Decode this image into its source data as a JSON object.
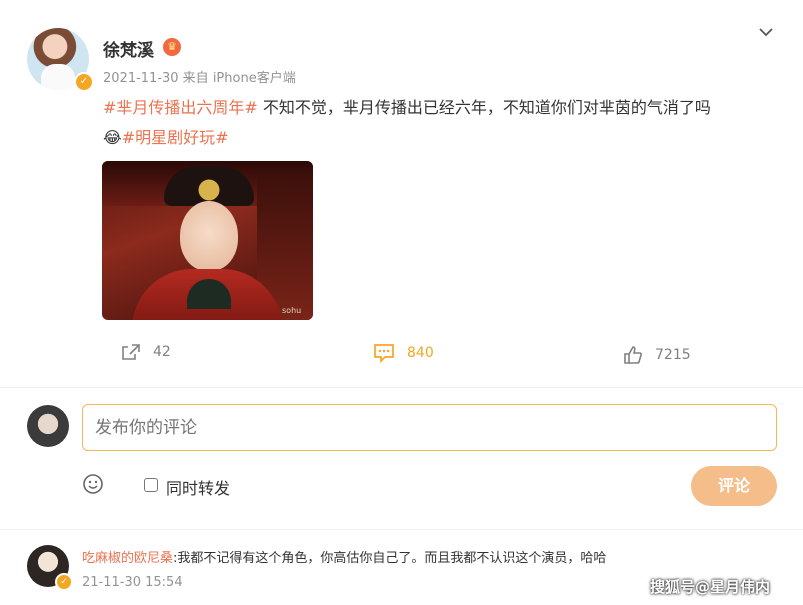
{
  "post": {
    "author": "徐梵溪",
    "meta": "2021-11-30  来自 iPhone客户端",
    "hashtag1": "#芈月传播出六周年#",
    "text": " 不知不觉，芈月传播出已经六年，不知道你们对芈茵的气消了吗",
    "emoji": "😂",
    "hashtag2": "#明星剧好玩#",
    "watermark": "sohu",
    "menu_icon": "chevron-down-icon"
  },
  "actions": {
    "repost_count": "42",
    "comment_count": "840",
    "like_count": "7215"
  },
  "composer": {
    "placeholder": "发布你的评论",
    "repost_label": "同时转发",
    "submit_label": "评论"
  },
  "comment": {
    "username": "吃麻椒的欧尼桑",
    "text": ":我都不记得有这个角色，你高估你自己了。而且我都不认识这个演员，哈哈",
    "time": "21-11-30 15:54"
  },
  "footer_watermark": "搜狐号@星月伟内",
  "colors": {
    "accent": "#eb7350",
    "comment_icon": "#f5a623",
    "button": "#f5bd8a"
  }
}
